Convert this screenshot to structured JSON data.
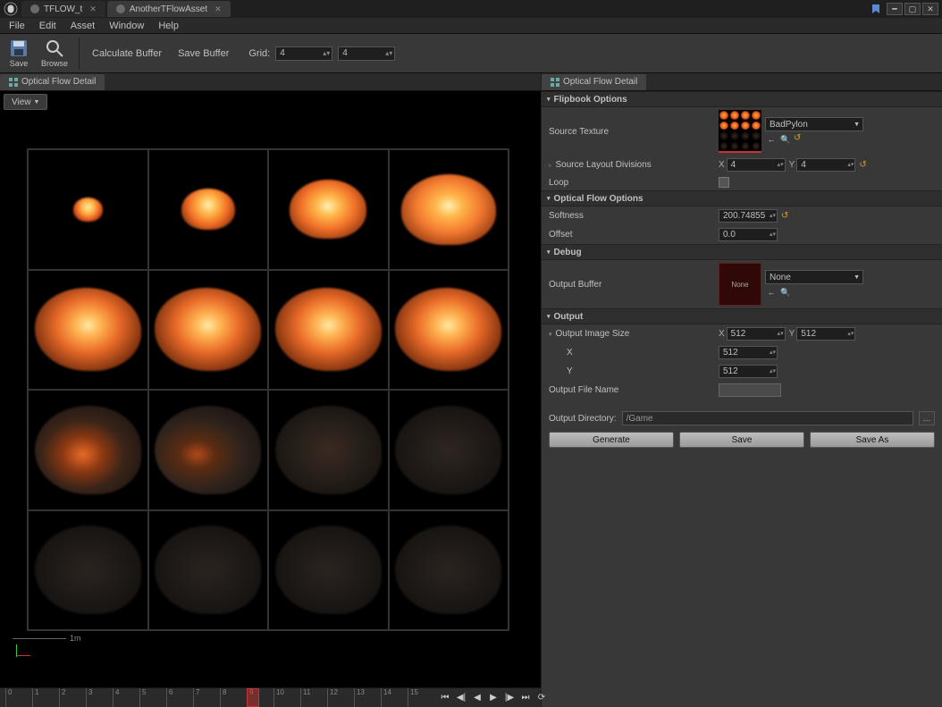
{
  "tabs": [
    {
      "label": "TFLOW_t"
    },
    {
      "label": "AnotherTFlowAsset"
    }
  ],
  "menu": {
    "file": "File",
    "edit": "Edit",
    "asset": "Asset",
    "window": "Window",
    "help": "Help"
  },
  "toolbar": {
    "save": "Save",
    "browse": "Browse",
    "calc_buffer": "Calculate Buffer",
    "save_buffer": "Save Buffer",
    "grid_label": "Grid:",
    "grid_x": "4",
    "grid_y": "4"
  },
  "panel_tab_left": "Optical Flow Detail",
  "panel_tab_right": "Optical Flow Detail",
  "view_button": "View",
  "scale_label": "1m",
  "timeline": {
    "ticks": [
      "0",
      "1",
      "2",
      "3",
      "4",
      "5",
      "6",
      "7",
      "8",
      "9",
      "10",
      "11",
      "12",
      "13",
      "14",
      "15"
    ],
    "cursor_index": 9
  },
  "details": {
    "cat_flipbook": "Flipbook Options",
    "source_texture_label": "Source Texture",
    "source_texture_value": "BadPylon",
    "source_layout_label": "Source Layout Divisions",
    "layout_x_label": "X",
    "layout_x": "4",
    "layout_y_label": "Y",
    "layout_y": "4",
    "loop_label": "Loop",
    "cat_opticalflow": "Optical Flow Options",
    "softness_label": "Softness",
    "softness": "200.74855",
    "offset_label": "Offset",
    "offset": "0.0",
    "cat_debug": "Debug",
    "output_buffer_label": "Output Buffer",
    "output_buffer_thumb": "None",
    "output_buffer_value": "None",
    "cat_output": "Output",
    "output_image_size_label": "Output Image Size",
    "out_x_label": "X",
    "out_x": "512",
    "out_y_label": "Y",
    "out_y": "512",
    "out_row_x_label": "X",
    "out_row_x": "512",
    "out_row_y_label": "Y",
    "out_row_y": "512",
    "output_filename_label": "Output File Name",
    "output_filename": "",
    "output_dir_label": "Output Directory:",
    "output_dir": "/Game",
    "generate": "Generate",
    "save": "Save",
    "saveas": "Save As"
  }
}
